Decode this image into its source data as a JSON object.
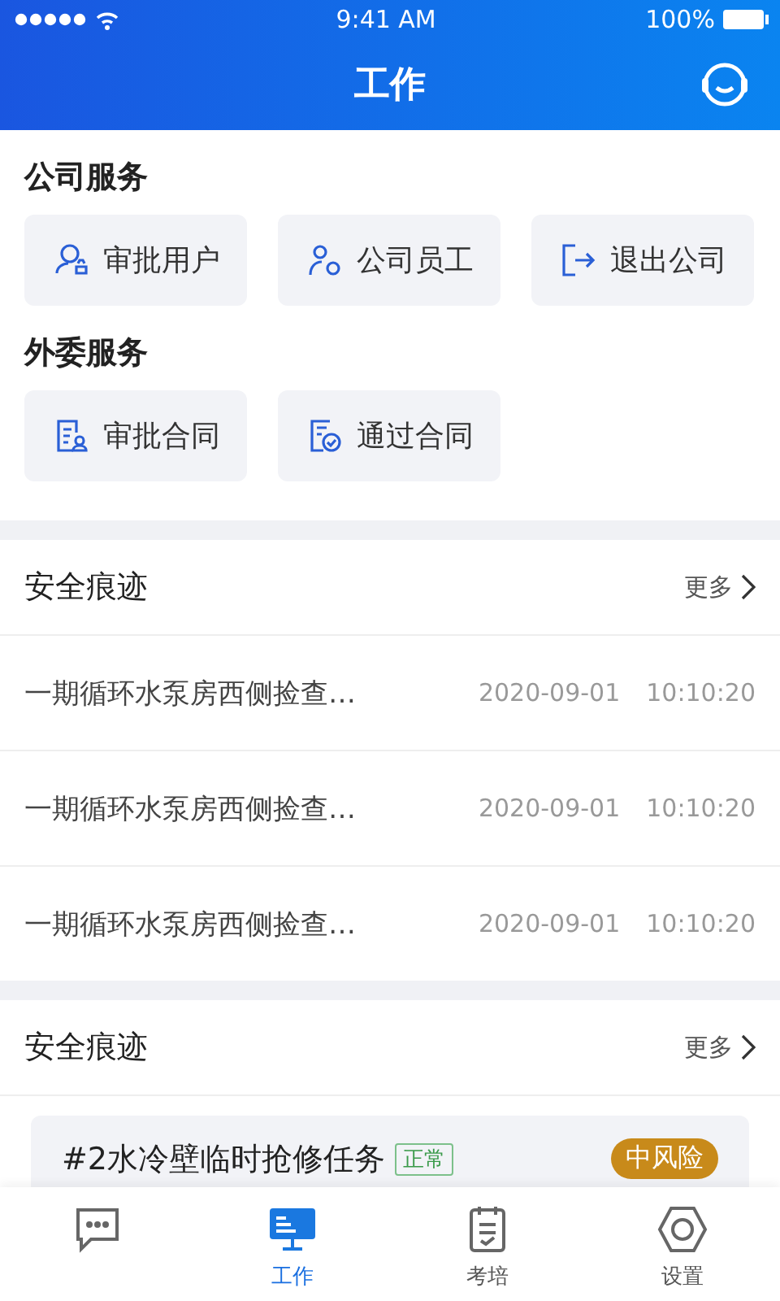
{
  "status_bar": {
    "time": "9:41 AM",
    "battery": "100%"
  },
  "nav": {
    "title": "工作"
  },
  "service_groups": [
    {
      "title": "公司服务",
      "items": [
        {
          "label": "审批用户"
        },
        {
          "label": "公司员工"
        },
        {
          "label": "退出公司"
        }
      ]
    },
    {
      "title": "外委服务",
      "items": [
        {
          "label": "审批合同"
        },
        {
          "label": "通过合同"
        }
      ]
    }
  ],
  "trace_section": {
    "title": "安全痕迹",
    "more": "更多",
    "rows": [
      {
        "text": "一期循环水泵房西侧捡查…",
        "date": "2020-09-01",
        "time": "10:10:20"
      },
      {
        "text": "一期循环水泵房西侧捡查…",
        "date": "2020-09-01",
        "time": "10:10:20"
      },
      {
        "text": "一期循环水泵房西侧捡查…",
        "date": "2020-09-01",
        "time": "10:10:20"
      }
    ]
  },
  "task_section": {
    "title": "安全痕迹",
    "more": "更多",
    "tasks": [
      {
        "title": "#2水冷壁临时抢修任务",
        "status": "正常",
        "risk": "中风险"
      }
    ]
  },
  "tab_bar": [
    {
      "selected": false
    },
    {
      "label": "工作",
      "selected": true
    },
    {
      "label": "考培",
      "selected": false
    },
    {
      "label": "设置",
      "selected": false
    }
  ]
}
